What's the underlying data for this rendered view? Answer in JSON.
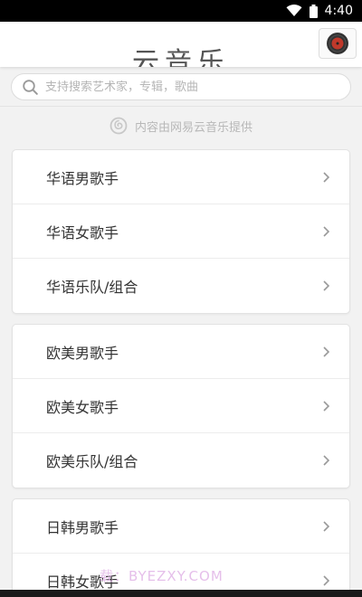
{
  "status_bar": {
    "time": "4:40"
  },
  "header": {
    "title": "云音乐"
  },
  "search": {
    "placeholder": "支持搜索艺术家，专辑，歌曲"
  },
  "provider": {
    "text": "内容由网易云音乐提供"
  },
  "categories": [
    {
      "items": [
        {
          "label": "华语男歌手"
        },
        {
          "label": "华语女歌手"
        },
        {
          "label": "华语乐队/组合"
        }
      ]
    },
    {
      "items": [
        {
          "label": "欧美男歌手"
        },
        {
          "label": "欧美女歌手"
        },
        {
          "label": "欧美乐队/组合"
        }
      ]
    },
    {
      "items": [
        {
          "label": "日韩男歌手"
        },
        {
          "label": "日韩女歌手"
        }
      ]
    }
  ],
  "watermark": {
    "text": "载：BYEZXY.COM"
  },
  "colors": {
    "accent": "#c0392b",
    "background": "#f2f2f2",
    "card": "#ffffff"
  }
}
